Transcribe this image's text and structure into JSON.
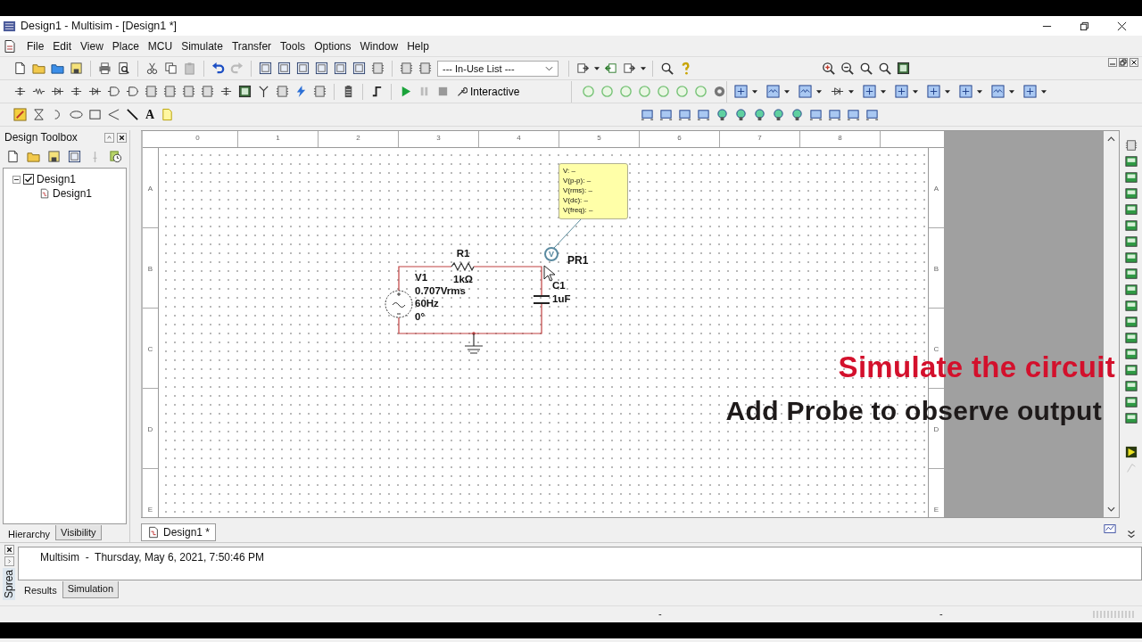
{
  "window": {
    "title": "Design1 - Multisim - [Design1 *]"
  },
  "menu": [
    "File",
    "Edit",
    "View",
    "Place",
    "MCU",
    "Simulate",
    "Transfer",
    "Tools",
    "Options",
    "Window",
    "Help"
  ],
  "toolbar": {
    "component_list": {
      "value": "--- In-Use List ---"
    },
    "run_mode": "Interactive",
    "text_tool": "A"
  },
  "design_toolbox": {
    "title": "Design Toolbox",
    "tree": [
      {
        "label": "Design1",
        "checked": true,
        "expanded": true,
        "children": [
          {
            "label": "Design1"
          }
        ]
      }
    ],
    "tabs": [
      {
        "label": "Hierarchy",
        "selected": true
      },
      {
        "label": "Visibility",
        "selected": false
      }
    ]
  },
  "canvas": {
    "ruler_columns": [
      "0",
      "1",
      "2",
      "3",
      "4",
      "5",
      "6",
      "7",
      "8"
    ],
    "ruler_rows_left": [
      "A",
      "B",
      "C",
      "D",
      "E"
    ],
    "ruler_rows_right": [
      "A",
      "B",
      "C",
      "D",
      "E"
    ],
    "components": [
      {
        "kind": "ac_source",
        "labels": [
          "V1",
          "0.707Vrms",
          "60Hz",
          "0°"
        ]
      },
      {
        "kind": "resistor",
        "labels": [
          "R1",
          "1kΩ"
        ]
      },
      {
        "kind": "capacitor",
        "labels": [
          "C1",
          "1uF"
        ]
      }
    ],
    "probe": {
      "symbol": "V",
      "label": "PR1",
      "readings": [
        "V: –",
        "V(p-p): –",
        "V(rms): –",
        "V(dc): –",
        "V(freq): –"
      ]
    },
    "captions": [
      {
        "text": "Simulate the circuit",
        "color": "#d3102c"
      },
      {
        "text": "Add Probe to observe output",
        "color": "#1e1a1a"
      }
    ]
  },
  "document_tabs": [
    {
      "label": "Design1 *",
      "selected": true
    }
  ],
  "spreadsheet": {
    "title": "Sprea",
    "message": "Multisim  -  Thursday, May 6, 2021, 7:50:46 PM",
    "tabs": [
      {
        "label": "Results",
        "selected": true
      },
      {
        "label": "Simulation",
        "selected": false
      }
    ]
  },
  "status_bar": [
    "-",
    "-"
  ]
}
